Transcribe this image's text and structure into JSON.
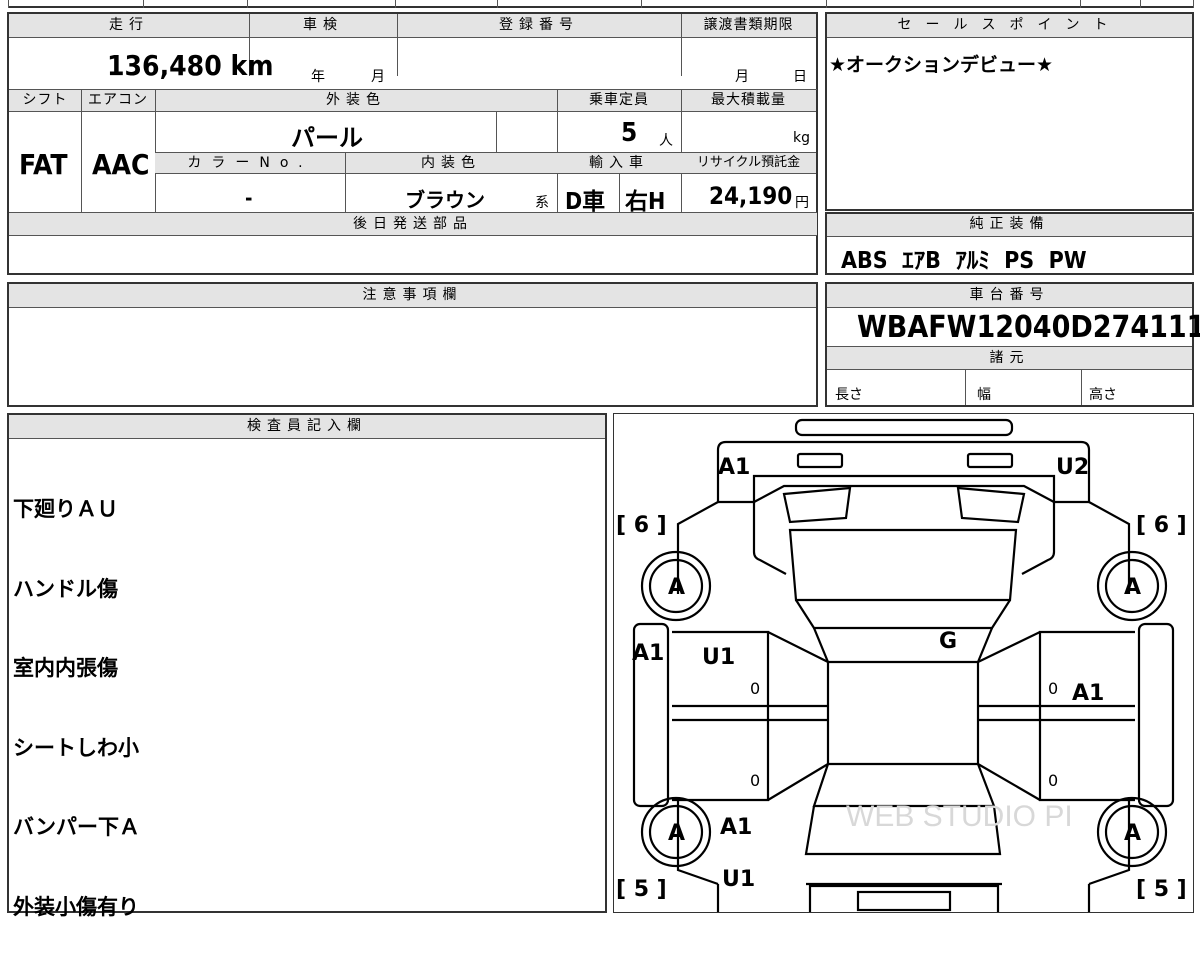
{
  "top_strip": {
    "partial_text": ""
  },
  "vehicle": {
    "mileage_label": "走行",
    "mileage_value": "136,480",
    "mileage_unit": "km",
    "inspection_label": "車検",
    "inspection_year": "年",
    "inspection_month": "月",
    "registration_label": "登録番号",
    "transfer_deadline_label": "譲渡書類期限",
    "transfer_month": "月",
    "transfer_day": "日",
    "shift_label": "シフト",
    "shift_value": "FAT",
    "aircon_label": "エアコン",
    "aircon_value": "AAC",
    "exterior_color_label": "外装色",
    "exterior_color_value": "パール",
    "capacity_label": "乗車定員",
    "capacity_value": "5",
    "capacity_unit": "人",
    "max_load_label": "最大積載量",
    "max_load_unit": "kg",
    "color_no_label": "カラーNo.",
    "color_no_value": "-",
    "interior_color_label": "内装色",
    "interior_color_value": "ブラウン",
    "interior_color_suffix": "系",
    "import_label": "輸入車",
    "import_dealer": "D車",
    "import_handle": "右H",
    "recycle_label": "リサイクル預託金",
    "recycle_value": "24,190",
    "recycle_unit": "円",
    "later_parts_label": "後日発送部品"
  },
  "sales_point": {
    "label": "セールスポイント",
    "text": "★オークションデビュー★"
  },
  "genuine_equipment": {
    "label": "純正装備",
    "text": "ABS  ｴｱB  ｱﾙﾐ  PS  PW"
  },
  "notes": {
    "label": "注意事項欄"
  },
  "chassis": {
    "label": "車台番号",
    "number": "WBAFW12040D274111",
    "specs_label": "諸元",
    "length_label": "長さ",
    "width_label": "幅",
    "height_label": "高さ"
  },
  "inspector": {
    "label": "検査員記入欄",
    "lines": [
      "下廻りＡＵ",
      "ハンドル傷",
      "室内内張傷",
      "シートしわ小",
      "バンパー下Ａ",
      "外装小傷有り"
    ]
  },
  "diagram": {
    "front_left": "A1",
    "front_right": "U2",
    "tire_front_left": "[ 6 ]",
    "tire_front_right": "[ 6 ]",
    "tire_rear_left": "[ 5 ]",
    "tire_rear_right": "[ 5 ]",
    "wheel_fl": "A",
    "wheel_fr": "A",
    "wheel_rl": "A",
    "wheel_rr": "A",
    "windshield": "G",
    "left_side": "A1",
    "front_door_left": "U1",
    "rear_right_door": "A1",
    "rear_left_quarter": "A1",
    "rear_left_bottom": "U1",
    "door_mark": "0",
    "watermark": "WEB STUDIO PI"
  }
}
